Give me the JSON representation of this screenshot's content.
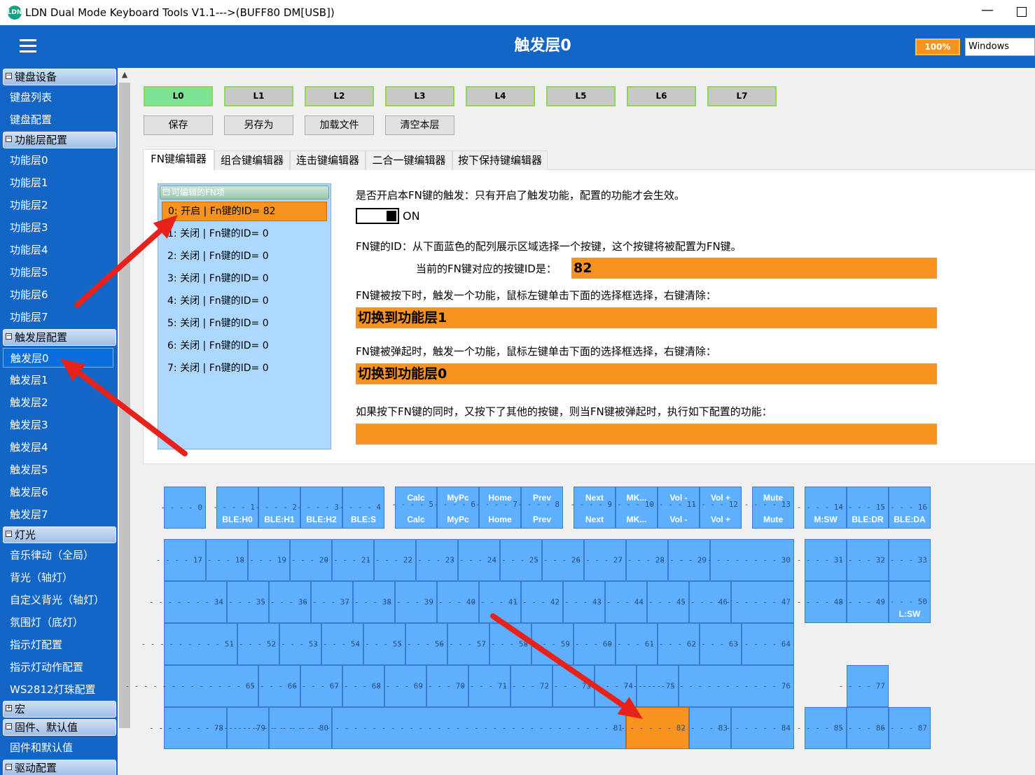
{
  "window": {
    "title": "LDN Dual Mode Keyboard Tools V1.1--->(BUFF80 DM[USB])",
    "icon_text": "LDN",
    "minimize_glyph": "—"
  },
  "header": {
    "title": "触发层0",
    "zoom": "100%",
    "os": "Windows"
  },
  "sidebar": {
    "groups": {
      "keyboard": "键盘设备",
      "fnlayer": "功能层配置",
      "trigger": "触发层配置",
      "light": "灯光",
      "macro": "宏",
      "firmware": "固件、默认值",
      "driver": "驱动配置"
    },
    "keyboard_items": [
      "键盘列表",
      "键盘配置"
    ],
    "fn_items": [
      "功能层0",
      "功能层1",
      "功能层2",
      "功能层3",
      "功能层4",
      "功能层5",
      "功能层6",
      "功能层7"
    ],
    "trigger_items": [
      "触发层0",
      "触发层1",
      "触发层2",
      "触发层3",
      "触发层4",
      "触发层5",
      "触发层6",
      "触发层7"
    ],
    "light_items": [
      "音乐律动（全局）",
      "背光（轴灯）",
      "自定义背光（轴灯）",
      "氛围灯（底灯）",
      "指示灯配置",
      "指示灯动作配置",
      "WS2812灯珠配置"
    ],
    "firmware_items": [
      "固件和默认值"
    ],
    "collapse_glyph": "−",
    "expand_glyph": "+"
  },
  "layers": [
    "L0",
    "L1",
    "L2",
    "L3",
    "L4",
    "L5",
    "L6",
    "L7"
  ],
  "actions": {
    "save": "保存",
    "save_as": "另存为",
    "load": "加载文件",
    "clear": "清空本层"
  },
  "tabs": [
    "FN键编辑器",
    "组合键编辑器",
    "连击键编辑器",
    "二合一键编辑器",
    "按下保持键编辑器"
  ],
  "fn_list": {
    "header": "可编辑的FN项",
    "items": [
      "0: 开启 | Fn键的ID= 82",
      "1: 关闭 | Fn键的ID= 0",
      "2: 关闭 | Fn键的ID= 0",
      "3: 关闭 | Fn键的ID= 0",
      "4: 关闭 | Fn键的ID= 0",
      "5: 关闭 | Fn键的ID= 0",
      "6: 关闭 | Fn键的ID= 0",
      "7: 关闭 | Fn键的ID= 0"
    ]
  },
  "editor": {
    "enable_label": "是否开启本FN键的触发：只有开启了触发功能，配置的功能才会生效。",
    "toggle_state": "ON",
    "id_label": "FN键的ID：从下面蓝色的配列展示区域选择一个按键，这个按键将被配置为FN键。",
    "current_id_label": "当前的FN键对应的按键ID是：",
    "current_id": "82",
    "press_label": "FN键被按下时，触发一个功能，鼠标左键单击下面的选择框选择，右键清除：",
    "press_value": "切换到功能层1",
    "release_label": "FN键被弹起时，触发一个功能，鼠标左键单击下面的选择框选择，右键清除：",
    "release_value": "切换到功能层0",
    "combo_label": "如果按下FN键的同时，又按下了其他的按键，则当FN键被弹起时，执行如下配置的功能：",
    "combo_value": ""
  },
  "key_labels": {
    "1": [
      "",
      "BLE:H0"
    ],
    "2": [
      "",
      "BLE:H1"
    ],
    "3": [
      "",
      "BLE:H2"
    ],
    "4": [
      "",
      "BLE:S"
    ],
    "5": [
      "Calc",
      "Calc"
    ],
    "6": [
      "MyPc",
      "MyPc"
    ],
    "7": [
      "Home",
      "Home"
    ],
    "8": [
      "Prev",
      "Prev"
    ],
    "9": [
      "Next",
      "Next"
    ],
    "10": [
      "MK...",
      "MK..."
    ],
    "11": [
      "Vol -",
      "Vol -"
    ],
    "12": [
      "Vol +",
      "Vol +"
    ],
    "13": [
      "Mute",
      "Mute"
    ],
    "14": [
      "",
      "M:SW"
    ],
    "15": [
      "",
      "BLE:DR"
    ],
    "16": [
      "",
      "BLE:DA"
    ],
    "50": [
      "",
      "L:SW"
    ]
  },
  "highlighted_key": 82,
  "colors": {
    "accent": "#1466c6",
    "orange": "#f7931e",
    "key": "#5eb0ff",
    "layer_active": "#7ce393",
    "arrow": "#e8211b"
  }
}
